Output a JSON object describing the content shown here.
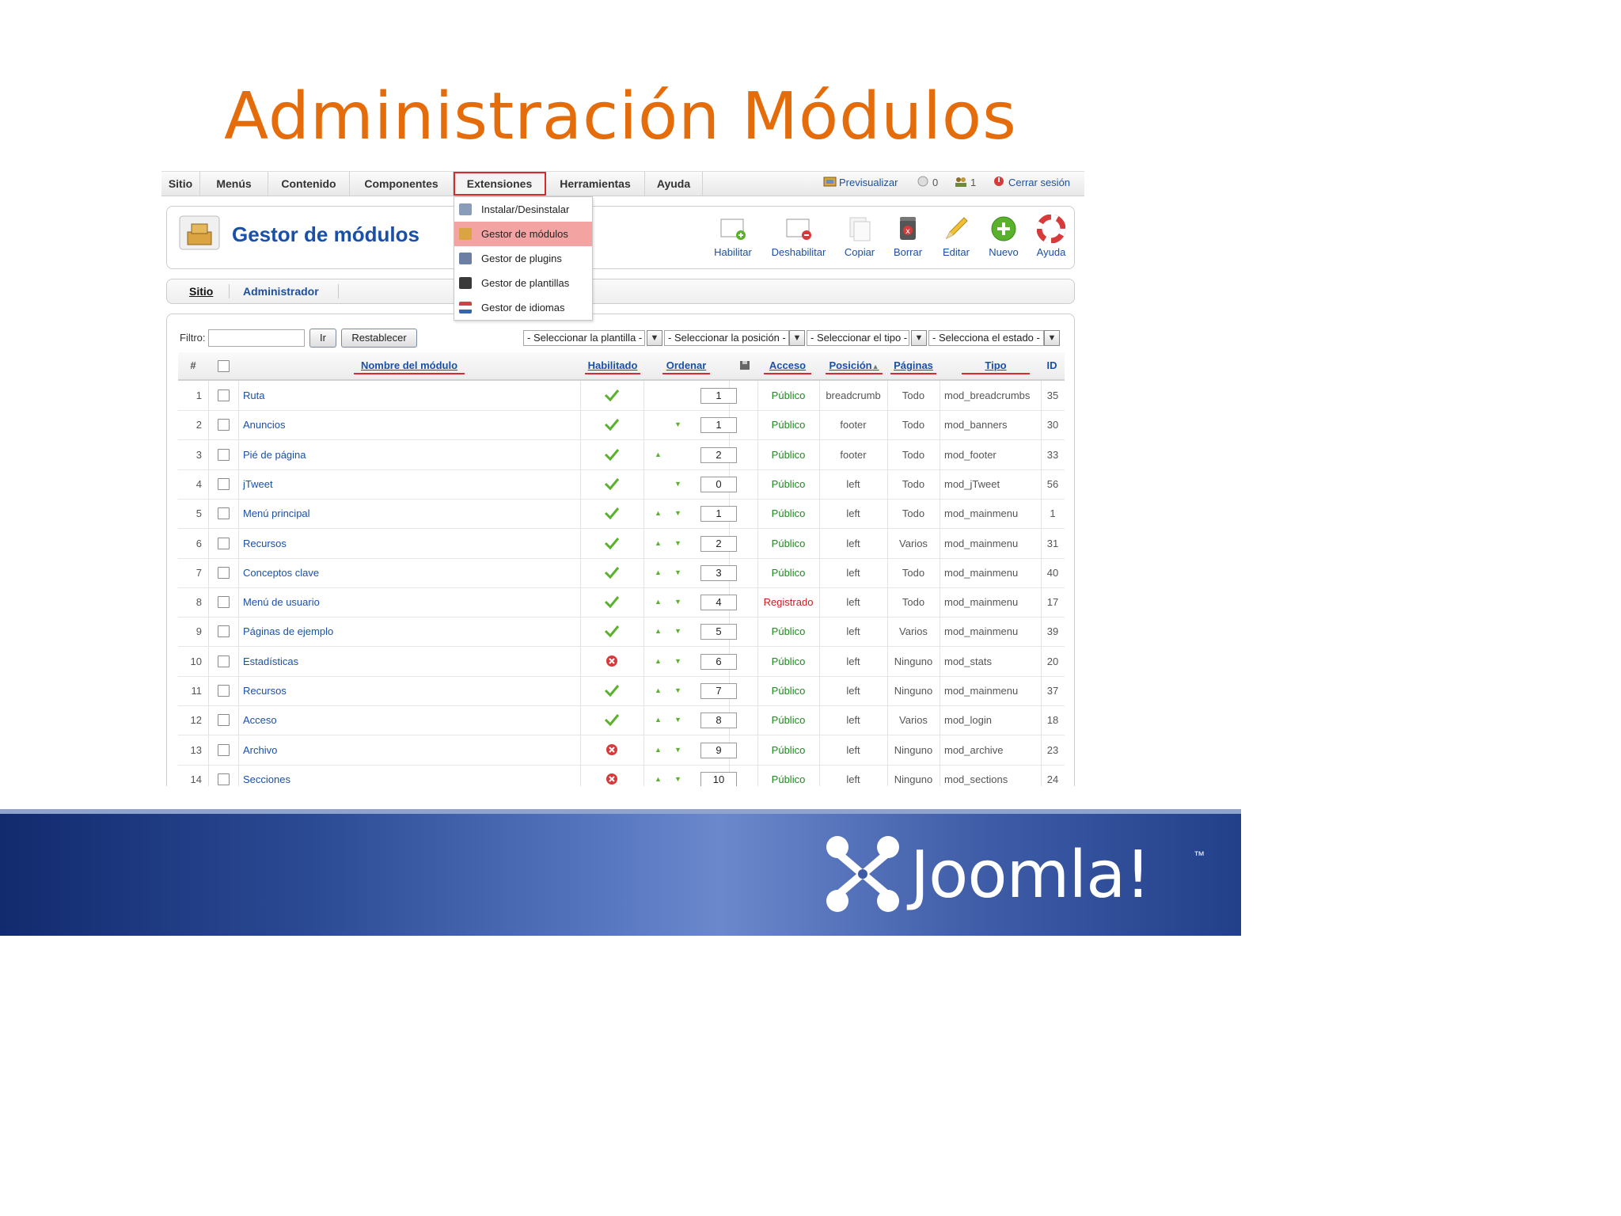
{
  "slide": {
    "title": "Administración Módulos"
  },
  "menubar": {
    "items": [
      "Sitio",
      "Menús",
      "Contenido",
      "Componentes",
      "Extensiones",
      "Herramientas",
      "Ayuda"
    ],
    "preview": "Previsualizar",
    "messages_count": "0",
    "users_count": "1",
    "logout": "Cerrar sesión"
  },
  "dropdown": {
    "items": [
      "Instalar/Desinstalar",
      "Gestor de módulos",
      "Gestor de plugins",
      "Gestor de plantillas",
      "Gestor de idiomas"
    ],
    "selected": "Gestor de módulos"
  },
  "header": {
    "title": "Gestor de módulos"
  },
  "toolbar": [
    "Habilitar",
    "Deshabilitar",
    "Copiar",
    "Borrar",
    "Editar",
    "Nuevo",
    "Ayuda"
  ],
  "tabs": [
    "Sitio",
    "Administrador"
  ],
  "filter": {
    "label": "Filtro:",
    "value": "",
    "go": "Ir",
    "reset": "Restablecer",
    "selects": [
      "- Seleccionar la plantilla -",
      "- Seleccionar la posición -",
      "- Seleccionar el tipo -",
      "- Selecciona el estado -"
    ]
  },
  "table": {
    "headers": [
      "#",
      "Nombre del módulo",
      "Habilitado",
      "Ordenar",
      "Acceso",
      "Posición",
      "Páginas",
      "Tipo",
      "ID"
    ],
    "rows": [
      {
        "n": "1",
        "name": "Ruta",
        "enabled": true,
        "up": false,
        "down": false,
        "order": "1",
        "access": "Público",
        "position": "breadcrumb",
        "pages": "Todo",
        "type": "mod_breadcrumbs",
        "id": "35"
      },
      {
        "n": "2",
        "name": "Anuncios",
        "enabled": true,
        "up": false,
        "down": true,
        "order": "1",
        "access": "Público",
        "position": "footer",
        "pages": "Todo",
        "type": "mod_banners",
        "id": "30"
      },
      {
        "n": "3",
        "name": "Pié de página",
        "enabled": true,
        "up": true,
        "down": false,
        "order": "2",
        "access": "Público",
        "position": "footer",
        "pages": "Todo",
        "type": "mod_footer",
        "id": "33"
      },
      {
        "n": "4",
        "name": "jTweet",
        "enabled": true,
        "up": false,
        "down": true,
        "order": "0",
        "access": "Público",
        "position": "left",
        "pages": "Todo",
        "type": "mod_jTweet",
        "id": "56"
      },
      {
        "n": "5",
        "name": "Menú principal",
        "enabled": true,
        "up": true,
        "down": true,
        "order": "1",
        "access": "Público",
        "position": "left",
        "pages": "Todo",
        "type": "mod_mainmenu",
        "id": "1"
      },
      {
        "n": "6",
        "name": "Recursos",
        "enabled": true,
        "up": true,
        "down": true,
        "order": "2",
        "access": "Público",
        "position": "left",
        "pages": "Varios",
        "type": "mod_mainmenu",
        "id": "31"
      },
      {
        "n": "7",
        "name": "Conceptos clave",
        "enabled": true,
        "up": true,
        "down": true,
        "order": "3",
        "access": "Público",
        "position": "left",
        "pages": "Todo",
        "type": "mod_mainmenu",
        "id": "40"
      },
      {
        "n": "8",
        "name": "Menú de usuario",
        "enabled": true,
        "up": true,
        "down": true,
        "order": "4",
        "access": "Registrado",
        "position": "left",
        "pages": "Todo",
        "type": "mod_mainmenu",
        "id": "17"
      },
      {
        "n": "9",
        "name": "Páginas de ejemplo",
        "enabled": true,
        "up": true,
        "down": true,
        "order": "5",
        "access": "Público",
        "position": "left",
        "pages": "Varios",
        "type": "mod_mainmenu",
        "id": "39"
      },
      {
        "n": "10",
        "name": "Estadísticas",
        "enabled": false,
        "up": true,
        "down": true,
        "order": "6",
        "access": "Público",
        "position": "left",
        "pages": "Ninguno",
        "type": "mod_stats",
        "id": "20"
      },
      {
        "n": "11",
        "name": "Recursos",
        "enabled": true,
        "up": true,
        "down": true,
        "order": "7",
        "access": "Público",
        "position": "left",
        "pages": "Ninguno",
        "type": "mod_mainmenu",
        "id": "37"
      },
      {
        "n": "12",
        "name": "Acceso",
        "enabled": true,
        "up": true,
        "down": true,
        "order": "8",
        "access": "Público",
        "position": "left",
        "pages": "Varios",
        "type": "mod_login",
        "id": "18"
      },
      {
        "n": "13",
        "name": "Archivo",
        "enabled": false,
        "up": true,
        "down": true,
        "order": "9",
        "access": "Público",
        "position": "left",
        "pages": "Ninguno",
        "type": "mod_archive",
        "id": "23"
      },
      {
        "n": "14",
        "name": "Secciones",
        "enabled": false,
        "up": true,
        "down": true,
        "order": "10",
        "access": "Público",
        "position": "left",
        "pages": "Ninguno",
        "type": "mod_sections",
        "id": "24"
      }
    ]
  },
  "footer": {
    "brand": "Joomla!",
    "trademark": "™"
  },
  "colors": {
    "title_orange": "#e46c0a",
    "link_blue": "#1a50a8",
    "public_green": "#1f8a1f",
    "registered_red": "#c41e1e"
  }
}
